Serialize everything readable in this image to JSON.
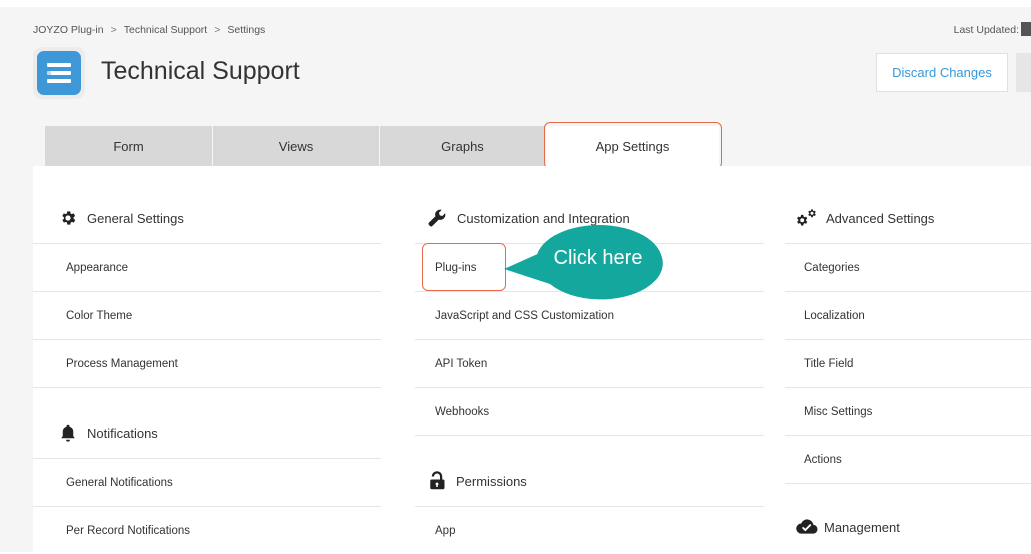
{
  "breadcrumb": {
    "items": [
      "JOYZO Plug-in",
      "Technical Support",
      "Settings"
    ],
    "separator": ">"
  },
  "header": {
    "app_title": "Technical Support",
    "last_updated_label": "Last Updated:",
    "discard_label": "Discard Changes"
  },
  "tabs": [
    {
      "label": "Form"
    },
    {
      "label": "Views"
    },
    {
      "label": "Graphs"
    },
    {
      "label": "App Settings",
      "active": true
    }
  ],
  "callout": {
    "text": "Click here"
  },
  "columns": {
    "general": {
      "title": "General Settings",
      "items": [
        "Appearance",
        "Color Theme",
        "Process Management"
      ]
    },
    "notifications": {
      "title": "Notifications",
      "items": [
        "General Notifications",
        "Per Record Notifications"
      ]
    },
    "customization": {
      "title": "Customization and Integration",
      "items": [
        "Plug-ins",
        "JavaScript and CSS Customization",
        "API Token",
        "Webhooks"
      ]
    },
    "permissions": {
      "title": "Permissions",
      "items": [
        "App"
      ]
    },
    "advanced": {
      "title": "Advanced Settings",
      "items": [
        "Categories",
        "Localization",
        "Title Field",
        "Misc Settings",
        "Actions"
      ]
    },
    "management": {
      "title": "Management"
    }
  },
  "colors": {
    "accent_blue": "#3498db",
    "highlight_border": "#e56b4a",
    "callout_teal": "#14a79d",
    "icon_blue": "#3e98d8"
  },
  "icons": {
    "app": "list-icon",
    "general": "gear-icon",
    "notifications": "bell-icon",
    "customization": "wrench-icon",
    "permissions": "lock-icon",
    "advanced": "gears-icon",
    "management": "cloud-check-icon"
  }
}
